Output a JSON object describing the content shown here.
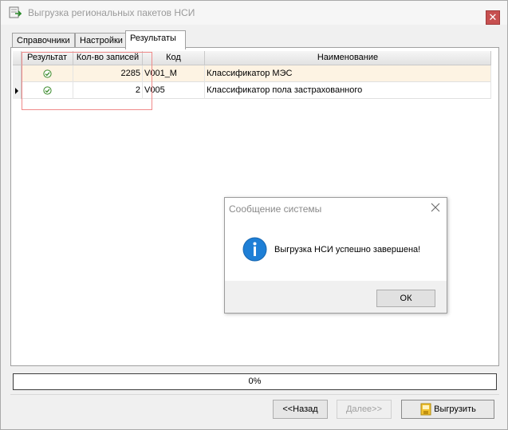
{
  "window": {
    "title": "Выгрузка региональных пакетов НСИ",
    "close_symbol": "✕"
  },
  "tabs": [
    {
      "label": "Справочники"
    },
    {
      "label": "Настройки"
    },
    {
      "label": "Результаты",
      "active": true
    }
  ],
  "grid": {
    "columns": [
      "Результат",
      "Кол-во записей",
      "Код",
      "Наименование"
    ],
    "rows": [
      {
        "result": "ok",
        "count": "2285",
        "code": "V001_M",
        "name": "Классификатор МЭС"
      },
      {
        "result": "ok",
        "count": "2",
        "code": "V005",
        "name": "Классификатор пола застрахованного"
      }
    ]
  },
  "dialog": {
    "title": "Сообщение системы",
    "message": "Выгрузка НСИ успешно завершена!",
    "ok_label": "ОК",
    "icon": "info-icon"
  },
  "progress": {
    "value": 0,
    "label": "0%"
  },
  "buttons": {
    "back_label": "<<Назад",
    "next_label": "Далее>>",
    "upload_label": "Выгрузить"
  },
  "colors": {
    "selected_row": "#fdf3e3",
    "highlight_box": "#f08a8a",
    "info_blue": "#1e7fd6",
    "check_green": "#3a8a2a"
  }
}
